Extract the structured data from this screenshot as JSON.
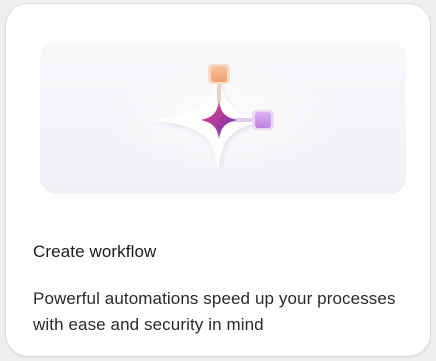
{
  "card": {
    "title": "Create workflow",
    "description": "Powerful automations speed up your processes with ease and security in mind"
  },
  "illustration": {
    "center_icon": "sparkle-star-icon",
    "top_node_icon": "orange-node-icon",
    "right_node_icon": "purple-node-icon",
    "colors": {
      "orange_node": "#f2b48a",
      "purple_node": "#c892e8",
      "star_start": "#e0467a",
      "star_end": "#5b3bb8",
      "background": "#f5f4f8"
    }
  }
}
